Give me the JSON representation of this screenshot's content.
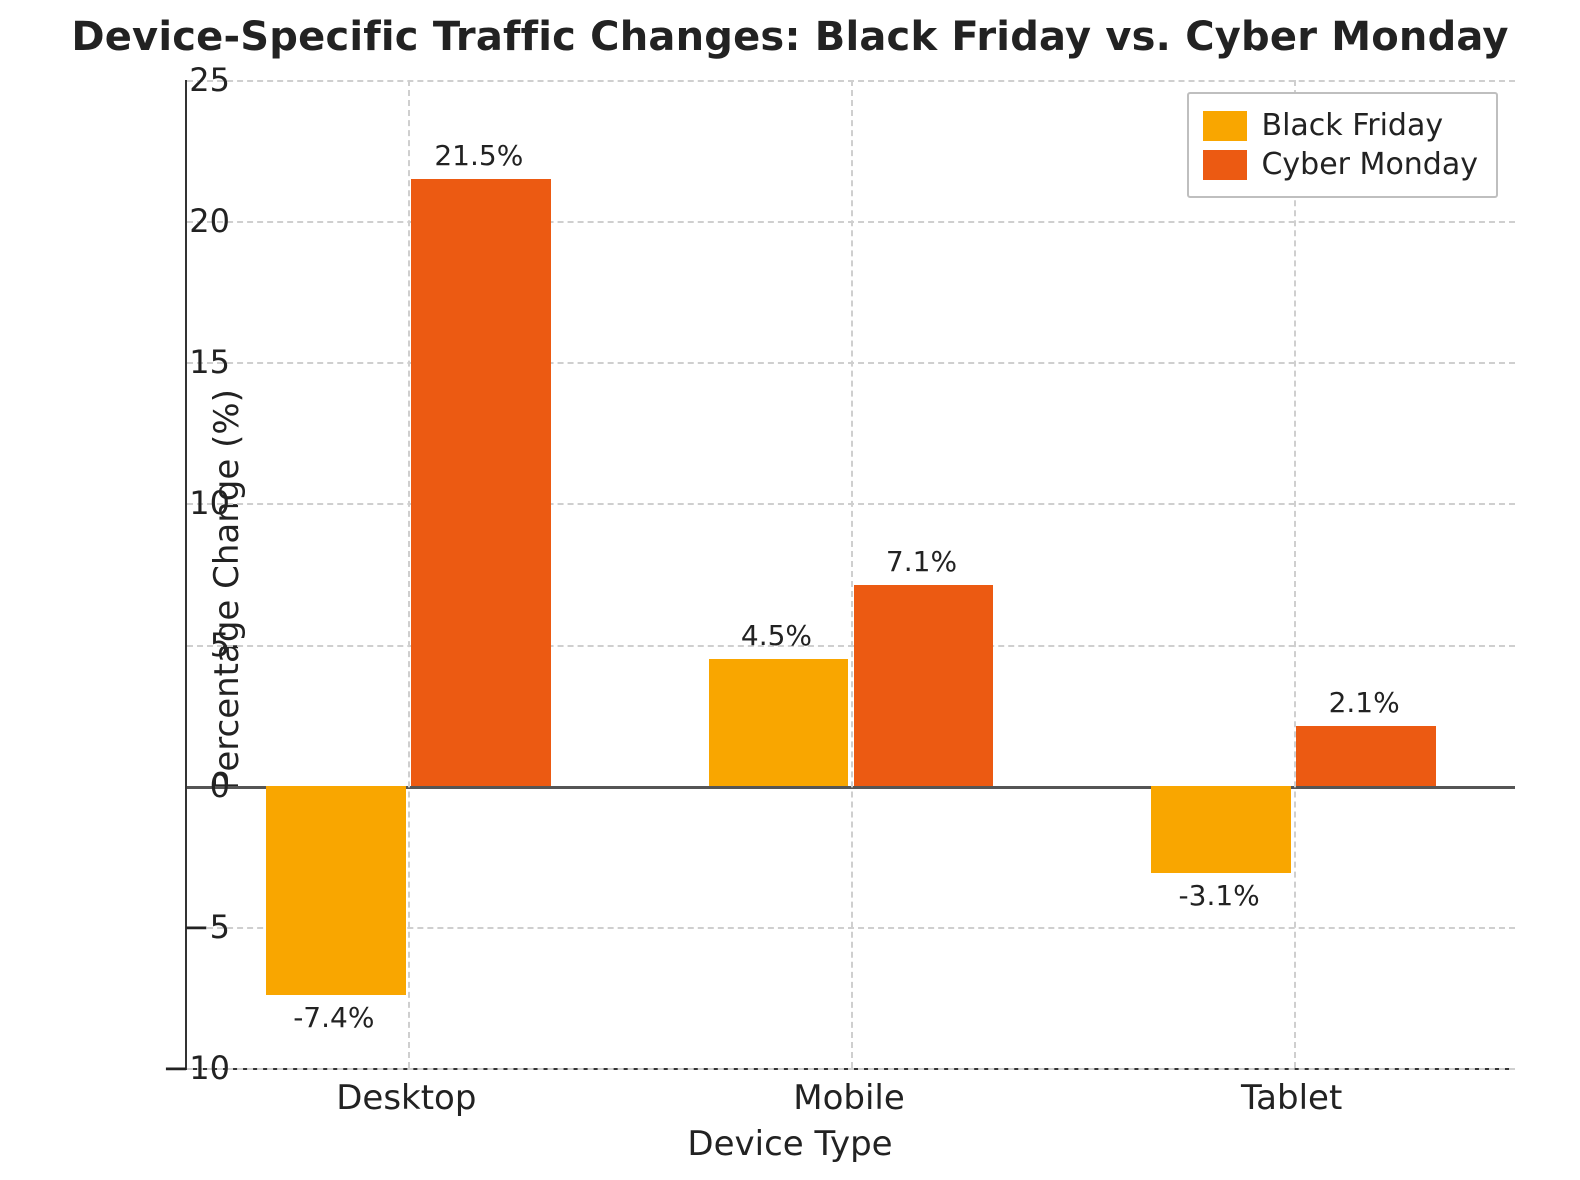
{
  "chart_data": {
    "type": "bar",
    "title": "Device-Specific Traffic Changes: Black Friday vs. Cyber Monday",
    "xlabel": "Device Type",
    "ylabel": "Percentage Change (%)",
    "categories": [
      "Desktop",
      "Mobile",
      "Tablet"
    ],
    "series": [
      {
        "name": "Black Friday",
        "values": [
          -7.4,
          4.5,
          -3.1
        ],
        "color": "#f9a600"
      },
      {
        "name": "Cyber Monday",
        "values": [
          21.5,
          7.1,
          2.1
        ],
        "color": "#ec5a12"
      }
    ],
    "ylim": [
      -10,
      25
    ],
    "yticks": [
      -10,
      -5,
      0,
      5,
      10,
      15,
      20,
      25
    ],
    "legend_position": "upper right",
    "grid": true,
    "value_label_suffix": "%"
  }
}
